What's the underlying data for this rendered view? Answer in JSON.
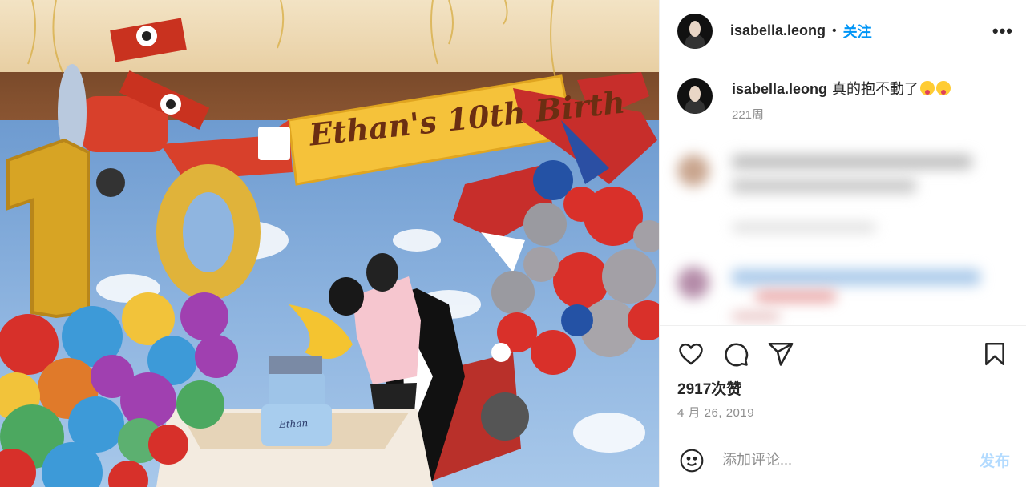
{
  "post": {
    "username": "isabella.leong",
    "follow_label": "关注",
    "more_label": "•••",
    "dot": "•"
  },
  "photo": {
    "banner_text": "Ethan's 10th Birth",
    "banner_letter": "E",
    "cake_text": "Ethan"
  },
  "caption": {
    "username": "isabella.leong",
    "text": "真的抱不動了",
    "emoji": [
      "squinting-face-with-tongue",
      "squinting-face-with-tongue"
    ],
    "time": "221周"
  },
  "actions": {
    "icons": [
      "heart-icon",
      "comment-icon",
      "share-icon",
      "bookmark-icon"
    ],
    "likes": "2917次赞",
    "date": "4 月 26, 2019"
  },
  "add_comment": {
    "placeholder": "添加评论...",
    "post_label": "发布"
  },
  "colors": {
    "accent": "#0095f6",
    "post_disabled": "#b3dbff",
    "muted": "#8e8e8e"
  }
}
